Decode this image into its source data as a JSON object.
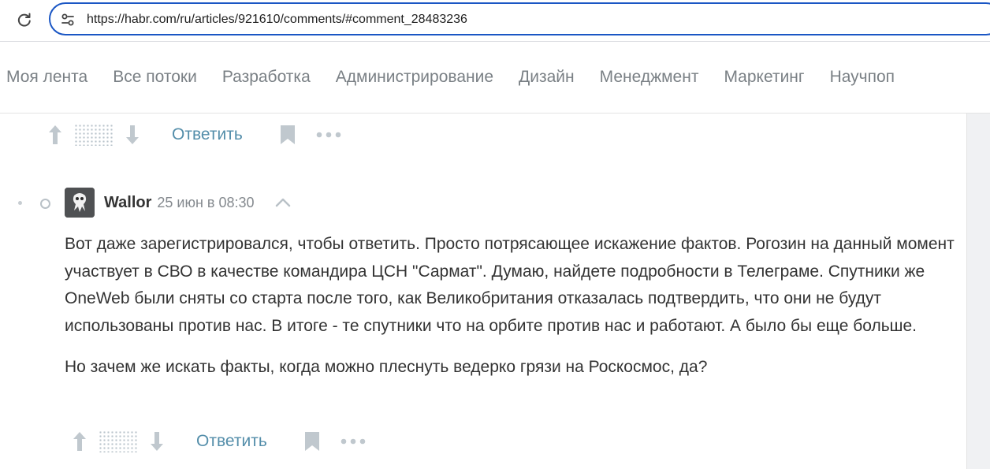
{
  "browser": {
    "url": "https://habr.com/ru/articles/921610/comments/#comment_28483236"
  },
  "nav": {
    "items": [
      "Моя лента",
      "Все потоки",
      "Разработка",
      "Администрирование",
      "Дизайн",
      "Менеджмент",
      "Маркетинг",
      "Научпоп"
    ]
  },
  "prev_comment_actions": {
    "reply_label": "Ответить"
  },
  "comment": {
    "author": "Wallor",
    "time": "25 июн в 08:30",
    "paragraphs": [
      "Вот даже зарегистрировался, чтобы ответить. Просто потрясающее искажение фактов. Рогозин на данный момент участвует в СВО в качестве командира ЦСН \"Сармат\". Думаю, найдете подробности в Телеграме. Спутники же OneWeb были сняты со старта после того, как Великобритания отказалась подтвердить, что они не будут использованы против нас. В итоге - те спутники что на орбите против нас и работают. А было бы еще больше.",
      "Но зачем же искать факты, когда можно плеснуть ведерко грязи на Роскосмос, да?"
    ],
    "reply_label": "Ответить"
  },
  "icons": {
    "reload": "reload-icon",
    "site_info": "site-info-icon",
    "upvote": "arrow-up-icon",
    "downvote": "arrow-down-icon",
    "bookmark": "bookmark-icon",
    "more": "more-dots-icon",
    "collapse": "chevron-up-icon"
  },
  "colors": {
    "accent_link": "#548eaa",
    "omnibox_border": "#1a56c4",
    "nav_text": "#7a8085",
    "icon_gray": "#c0c8ce"
  }
}
